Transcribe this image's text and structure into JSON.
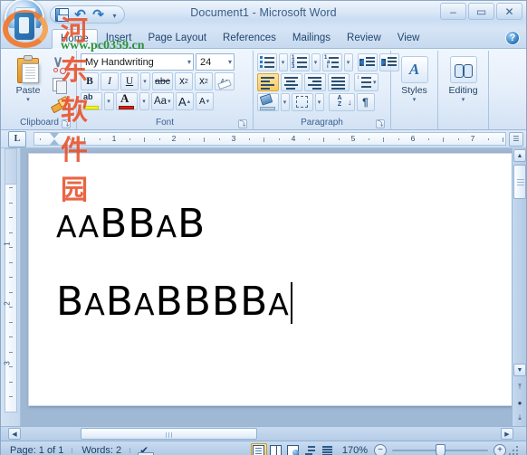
{
  "window": {
    "title": "Document1 - Microsoft Word",
    "minimize_label": "–",
    "maximize_label": "▭",
    "close_label": "✕",
    "office_button": "office-button",
    "help_label": "?"
  },
  "quick_access": {
    "items": [
      {
        "name": "save",
        "label": "■"
      },
      {
        "name": "undo",
        "label": "↶"
      },
      {
        "name": "redo",
        "label": "↷"
      },
      {
        "name": "customize",
        "label": "▾"
      }
    ]
  },
  "tabs": [
    {
      "label": "Home",
      "active": true
    },
    {
      "label": "Insert",
      "active": false
    },
    {
      "label": "Page Layout",
      "active": false
    },
    {
      "label": "References",
      "active": false
    },
    {
      "label": "Mailings",
      "active": false
    },
    {
      "label": "Review",
      "active": false
    },
    {
      "label": "View",
      "active": false
    }
  ],
  "ribbon": {
    "clipboard": {
      "label": "Clipboard",
      "paste_label": "Paste",
      "paste_caret": "▾",
      "cut_label": "Cut",
      "copy_label": "Copy",
      "painter_label": "Format Painter",
      "dialog_launcher": "⤵"
    },
    "font": {
      "label": "Font",
      "font_name": "My Handwriting",
      "font_size": "24",
      "arrow": "▾",
      "bold": "B",
      "italic": "I",
      "underline": "U",
      "strikethrough": "abc",
      "subscript": "x",
      "subscript_idx": "2",
      "superscript": "x",
      "superscript_idx": "2",
      "clear_formatting": "Aa",
      "highlight": "ab",
      "font_color": "A",
      "change_case": "Aa",
      "grow_font": "A",
      "shrink_font": "A",
      "dialog_launcher": "⤵"
    },
    "paragraph": {
      "label": "Paragraph",
      "bullets": "Bullets",
      "numbering": "Numbering",
      "multilevel": "Multilevel List",
      "decrease_indent": "Decrease Indent",
      "increase_indent": "Increase Indent",
      "align_left": "Align Left",
      "align_center": "Center",
      "align_right": "Align Right",
      "justify": "Justify",
      "line_spacing": "Line Spacing",
      "shading": "Shading",
      "borders": "Borders",
      "sort_a": "A",
      "sort_z": "Z",
      "sort_arrow": "↓",
      "show_marks": "¶",
      "dialog_launcher": "⤵"
    },
    "styles": {
      "label": "Styles",
      "icon": "styles-icon",
      "caret": "▾"
    },
    "editing": {
      "label": "Editing",
      "icon": "find-binoculars-icon",
      "caret": "▾"
    }
  },
  "ruler": {
    "tab_selector": "L",
    "numbers": [
      "1",
      "2",
      "3",
      "4",
      "5",
      "6",
      "7"
    ],
    "vertical_numbers": [
      "1",
      "2",
      "3"
    ],
    "end_button": "☰"
  },
  "document": {
    "lines": [
      {
        "text": "AABBAB"
      },
      {
        "text": "BABABBBBA"
      }
    ]
  },
  "scrollbars": {
    "up_arrow": "▲",
    "down_arrow": "▼",
    "left_arrow": "◀",
    "right_arrow": "▶",
    "previous_page": "⤒",
    "select_browse_object": "●",
    "next_page": "⤓"
  },
  "status": {
    "page": "Page: 1 of 1",
    "words": "Words: 2",
    "proofing": "proofing-errors-icon",
    "views": [
      {
        "name": "print-layout",
        "label": "Print Layout",
        "active": true
      },
      {
        "name": "full-screen-reading",
        "label": "Full Screen Reading",
        "active": false
      },
      {
        "name": "web-layout",
        "label": "Web Layout",
        "active": false
      },
      {
        "name": "outline",
        "label": "Outline",
        "active": false
      },
      {
        "name": "draft",
        "label": "Draft",
        "active": false
      }
    ],
    "zoom_level": "170%",
    "zoom_out": "−",
    "zoom_in": "+"
  },
  "watermark": {
    "site_name": "河东软件园",
    "site_url": "www.pc0359.cn"
  },
  "colors": {
    "accent": "#2f7ac0",
    "highlight_yellow": "#ffff00",
    "font_color_red": "#d81e05",
    "active_gold": "#f6c65c",
    "watermark_red": "#e8502a",
    "watermark_green": "#1f8a2b"
  }
}
